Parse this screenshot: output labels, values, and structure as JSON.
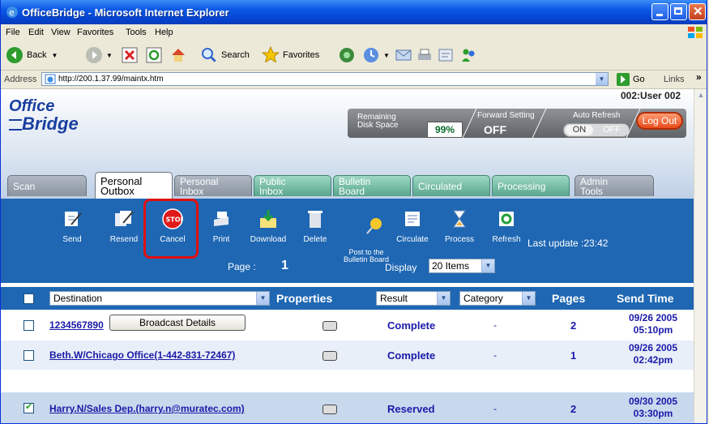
{
  "window": {
    "title": "OfficeBridge - Microsoft Internet Explorer"
  },
  "menu": [
    "File",
    "Edit",
    "View",
    "Favorites",
    "Tools",
    "Help"
  ],
  "toolbar": {
    "back": "Back",
    "search": "Search",
    "favorites": "Favorites"
  },
  "address": {
    "label": "Address",
    "url": "http://200.1.37.99/maintx.htm",
    "go": "Go",
    "links": "Links"
  },
  "header": {
    "logo_top": "Office",
    "logo_bottom": "Bridge",
    "user": "002:User 002",
    "disk_caption": "Remaining\nDisk Space",
    "disk_value": "99%",
    "forward_caption": "Forward Setting",
    "forward_value": "OFF",
    "refresh_caption": "Auto Refresh",
    "toggle_on": "ON",
    "toggle_off": "OFF",
    "logout": "Log Out"
  },
  "tabs": [
    {
      "label": "Scan"
    },
    {
      "label": "Personal\nOutbox"
    },
    {
      "label": "Personal\nInbox"
    },
    {
      "label": "Public\nInbox"
    },
    {
      "label": "Bulletin\nBoard"
    },
    {
      "label": "Circulated"
    },
    {
      "label": "Processing"
    },
    {
      "label": "Admin\nTools"
    }
  ],
  "actions": {
    "send": "Send",
    "resend": "Resend",
    "cancel": "Cancel",
    "print": "Print",
    "download": "Download",
    "delete": "Delete",
    "post": "Post to the\nBulletin Board",
    "circulate": "Circulate",
    "process": "Process",
    "refresh": "Refresh",
    "last_update": "Last update :23:42",
    "page_label": "Page :",
    "page_value": "1",
    "display_label": "Display",
    "display_value": "20 Items"
  },
  "columns": {
    "destination": "Destination",
    "properties": "Properties",
    "result": "Result",
    "category": "Category",
    "pages": "Pages",
    "send_time": "Send Time"
  },
  "rows": [
    {
      "destination": "1234567890",
      "button": "Broadcast Details",
      "result": "Complete",
      "category": "-",
      "pages": "2",
      "date": "09/26 2005",
      "time": "05:10pm",
      "checked": false
    },
    {
      "destination": "Beth.W/Chicago Office(1-442-831-72467)",
      "result": "Complete",
      "category": "-",
      "pages": "1",
      "date": "09/26 2005",
      "time": "02:42pm",
      "checked": false
    },
    {
      "destination": "Harry.N/Sales Dep.(harry.n@muratec.com)",
      "result": "Reserved",
      "category": "-",
      "pages": "2",
      "date": "09/30 2005",
      "time": "03:30pm",
      "checked": true
    }
  ]
}
